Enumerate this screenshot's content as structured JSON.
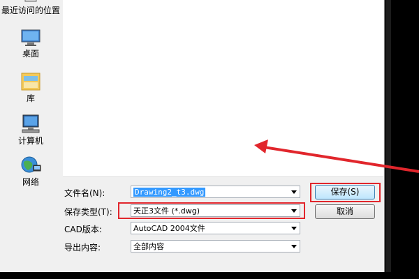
{
  "sidebar": {
    "items": [
      {
        "label": "最近访问的位置",
        "icon": "recent-places-icon"
      },
      {
        "label": "桌面",
        "icon": "desktop-icon"
      },
      {
        "label": "库",
        "icon": "libraries-icon"
      },
      {
        "label": "计算机",
        "icon": "computer-icon"
      },
      {
        "label": "网络",
        "icon": "network-icon"
      }
    ]
  },
  "form": {
    "filename_label": "文件名(N):",
    "filename_value": "Drawing2_t3.dwg",
    "filetype_label": "保存类型(T):",
    "filetype_value": "天正3文件 (*.dwg)",
    "cad_version_label": "CAD版本:",
    "cad_version_value": "AutoCAD 2004文件",
    "export_label": "导出内容:",
    "export_value": "全部内容"
  },
  "buttons": {
    "save": "保存(S)",
    "cancel": "取消"
  },
  "colors": {
    "annotation_red": "#e1262c",
    "selection_blue": "#3399ff"
  }
}
